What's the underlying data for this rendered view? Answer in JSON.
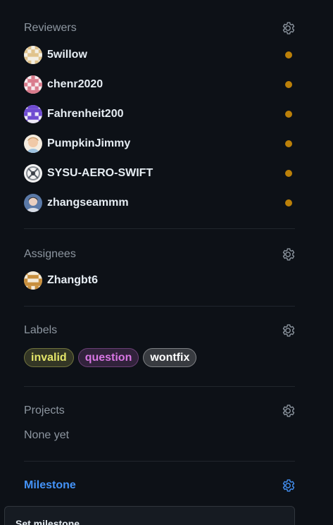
{
  "reviewers": {
    "title": "Reviewers",
    "items": [
      {
        "name": "5willow",
        "status": "pending"
      },
      {
        "name": "chenr2020",
        "status": "pending"
      },
      {
        "name": "Fahrenheit200",
        "status": "pending"
      },
      {
        "name": "PumpkinJimmy",
        "status": "pending"
      },
      {
        "name": "SYSU-AERO-SWIFT",
        "status": "pending"
      },
      {
        "name": "zhangseammm",
        "status": "pending"
      }
    ]
  },
  "assignees": {
    "title": "Assignees",
    "items": [
      {
        "name": "Zhangbt6"
      }
    ]
  },
  "labels": {
    "title": "Labels",
    "items": [
      {
        "name": "invalid",
        "color": "#e4e669"
      },
      {
        "name": "question",
        "color": "#d876e3"
      },
      {
        "name": "wontfix",
        "color": "#ffffff"
      }
    ]
  },
  "projects": {
    "title": "Projects",
    "empty_text": "None yet"
  },
  "milestone": {
    "title": "Milestone",
    "dropdown_title": "Set milestone"
  },
  "colors": {
    "background": "#0d1117",
    "pending": "#bb8009",
    "accent": "#4493f8",
    "muted": "#8d96a0"
  },
  "icons": {
    "settings": "gear-icon",
    "pending": "dot-icon"
  }
}
